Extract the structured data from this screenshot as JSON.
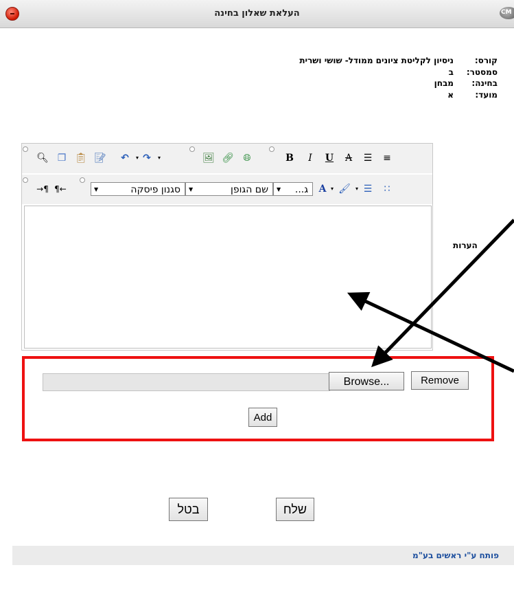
{
  "window": {
    "title": "העלאת שאלון בחינה",
    "logo_text": "CM"
  },
  "info": {
    "course_label": "קורס:",
    "course_value": "ניסיון לקליטת ציונים ממודל- שושי ושרית",
    "semester_label": "סמסטר:",
    "semester_value": "ב",
    "exam_label": "בחינה:",
    "exam_value": "מבחן",
    "session_label": "מועד:",
    "session_value": "א"
  },
  "editor": {
    "toolbar1_icons": [
      "find-icon",
      "copy-icon",
      "paste-icon",
      "paste-word-icon",
      "undo-icon",
      "redo-icon",
      "image-icon",
      "link-icon",
      "unlink-icon",
      "bold-icon",
      "italic-icon",
      "underline-icon",
      "strikethrough-icon",
      "align-right-icon",
      "align-justify-icon"
    ],
    "format_bold": "B",
    "format_italic": "I",
    "format_underline": "U",
    "format_strike": "A",
    "font_color_letter": "A",
    "paragraph_style": "סגנון פיסקה",
    "font_name": "שם הגופן",
    "font_size": "ג...",
    "notes_label": "הערות"
  },
  "upload": {
    "browse_label": "Browse...",
    "remove_label": "Remove",
    "add_label": "Add"
  },
  "actions": {
    "cancel_label": "בטל",
    "send_label": "שלח"
  },
  "footer": {
    "credit": "פותח ע\"י ראשים בע\"מ"
  },
  "colors": {
    "highlight_border": "#ee1111",
    "footer_text": "#1d4f9e",
    "close_button": "#d01800"
  }
}
